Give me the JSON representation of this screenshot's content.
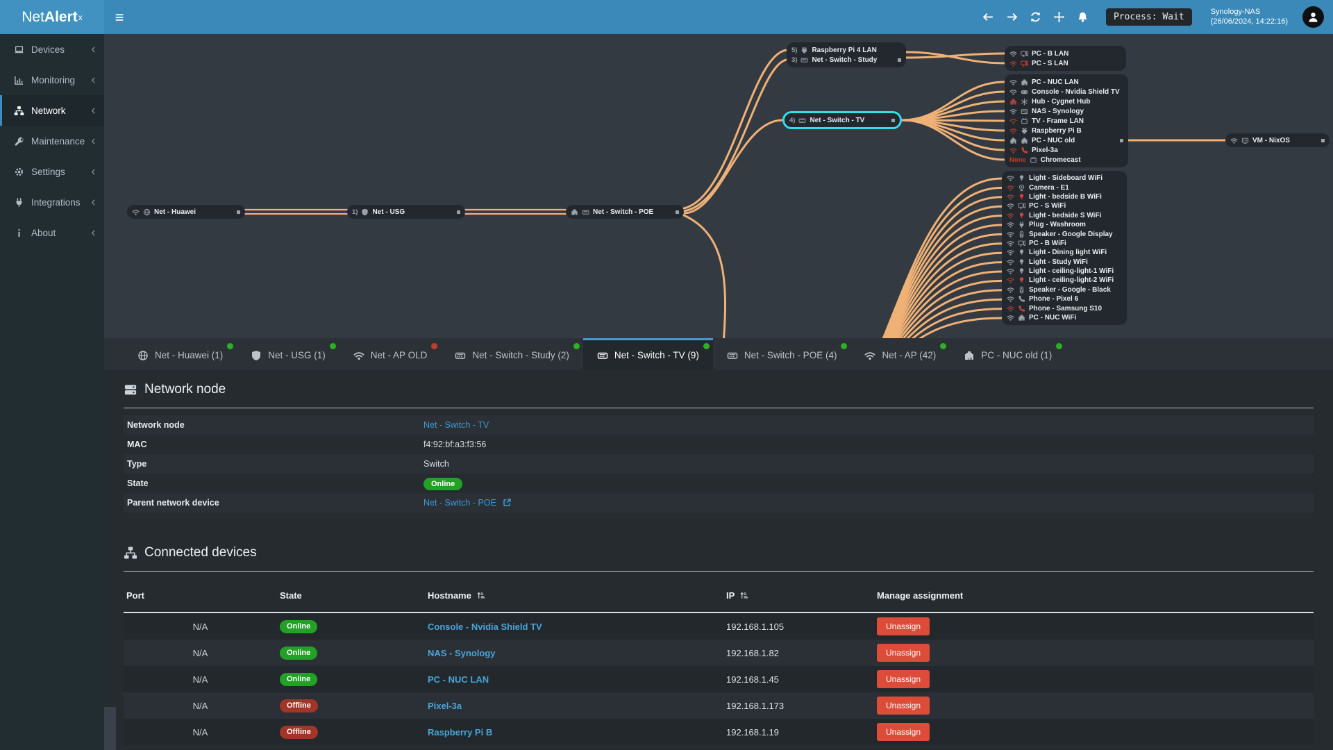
{
  "topbar": {
    "logo_net": "Net",
    "logo_alert": "Alert",
    "logo_sup": "x",
    "process_label": "Process: Wait",
    "host": "Synology-NAS",
    "timestamp": "(26/06/2024, 14:22:16)"
  },
  "sidebar": {
    "items": [
      {
        "icon": "laptop",
        "label": "Devices"
      },
      {
        "icon": "chart",
        "label": "Monitoring"
      },
      {
        "icon": "sitemap",
        "label": "Network",
        "cls": "active"
      },
      {
        "icon": "wrench",
        "label": "Maintenance"
      },
      {
        "icon": "gear",
        "label": "Settings"
      },
      {
        "icon": "plug",
        "label": "Integrations"
      },
      {
        "icon": "info",
        "label": "About"
      }
    ]
  },
  "diagram": {
    "edge_color": "#efb176",
    "selected_ring_color": "#2fdfe9",
    "chain": [
      {
        "conn": "wifi",
        "dev": "globe",
        "label": "Net - Huawei",
        "handle": "on"
      },
      {
        "prefix": "1)",
        "dev": "shield",
        "label": "Net - USG",
        "handle": "on"
      },
      {
        "conn": "ethernet",
        "dev": "switch",
        "label": "Net - Switch - POE",
        "handle": "on"
      }
    ],
    "study_cluster": [
      {
        "prefix": "5)",
        "dev": "raspberry",
        "label": "Raspberry Pi 4 LAN"
      },
      {
        "prefix": "3)",
        "dev": "switch",
        "label": "Net - Switch - Study",
        "handle": "on"
      }
    ],
    "lan_cluster": [
      {
        "conn": "wifi",
        "dev": "desktop",
        "label": "PC - B LAN"
      },
      {
        "conn": "wifi",
        "dev": "desktop",
        "label": "PC - S LAN",
        "status": "offline",
        "devred": "red"
      }
    ],
    "selected": {
      "prefix": "4)",
      "icon": "switch",
      "label": "Net - Switch - TV"
    },
    "tv_cluster": [
      {
        "conn": "wifi",
        "dev": "ethernet",
        "label": "PC - NUC LAN"
      },
      {
        "conn": "wifi",
        "dev": "gamepad",
        "label": "Console - Nvidia Shield TV"
      },
      {
        "conn": "ethernet",
        "dev": "hub",
        "label": "Hub - Cygnet Hub",
        "status": "offline"
      },
      {
        "conn": "wifi",
        "dev": "nas",
        "label": "NAS - Synology"
      },
      {
        "conn": "wifi",
        "dev": "tv",
        "label": "TV - Frame LAN",
        "status": "offline"
      },
      {
        "conn": "wifi",
        "dev": "raspberry",
        "label": "Raspberry Pi B",
        "status": "offline"
      },
      {
        "conn": "ethernet",
        "dev": "ethernet",
        "label": "PC - NUC old",
        "handle": "on"
      },
      {
        "conn": "wifi",
        "dev": "phone",
        "label": "Pixel-3a",
        "status": "offline",
        "devred": "red"
      },
      {
        "prefix": "None",
        "pclass": "red",
        "dev": "tv",
        "label": "Chromecast"
      }
    ],
    "vm": {
      "conn": "wifi",
      "dev": "vm",
      "label": "VM - NixOS",
      "handle": "on"
    },
    "ap_cluster": [
      {
        "conn": "wifi",
        "dev": "bulb",
        "label": "Light - Sideboard WiFi"
      },
      {
        "conn": "wifi",
        "dev": "camera",
        "label": "Camera - E1",
        "status": "offline"
      },
      {
        "conn": "wifi",
        "dev": "bulb",
        "label": "Light - bedside B WiFi",
        "status": "offline",
        "devred": "red"
      },
      {
        "conn": "wifi",
        "dev": "desktop",
        "label": "PC - S WiFi"
      },
      {
        "conn": "wifi",
        "dev": "bulb",
        "label": "Light - bedside S WiFi",
        "status": "offline",
        "devred": "red"
      },
      {
        "conn": "wifi",
        "dev": "plug",
        "label": "Plug - Washroom"
      },
      {
        "conn": "wifi",
        "dev": "speaker",
        "label": "Speaker - Google Display"
      },
      {
        "conn": "wifi",
        "dev": "desktop",
        "label": "PC - B WiFi"
      },
      {
        "conn": "wifi",
        "dev": "bulb",
        "label": "Light - Dining light WiFi"
      },
      {
        "conn": "wifi",
        "dev": "bulb",
        "label": "Light - Study WiFi"
      },
      {
        "conn": "wifi",
        "dev": "bulb",
        "label": "Light - ceiling-light-1 WiFi"
      },
      {
        "conn": "wifi",
        "dev": "bulb",
        "label": "Light - ceiling-light-2 WiFi",
        "status": "offline",
        "devred": "red"
      },
      {
        "conn": "wifi",
        "dev": "speaker",
        "label": "Speaker - Google - Black"
      },
      {
        "conn": "wifi",
        "dev": "phone",
        "label": "Phone - Pixel 6"
      },
      {
        "conn": "wifi",
        "dev": "phone",
        "label": "Phone - Samsung S10",
        "status": "offline",
        "devred": "red"
      },
      {
        "conn": "wifi",
        "dev": "ethernet",
        "label": "PC - NUC WiFi"
      }
    ]
  },
  "tabs": [
    {
      "icon": "globe",
      "label": "Net - Huawei (1)",
      "dot": "green"
    },
    {
      "icon": "shield",
      "label": "Net - USG (1)",
      "dot": "green"
    },
    {
      "icon": "wifi",
      "label": "Net - AP OLD",
      "dot": "red"
    },
    {
      "icon": "switch",
      "label": "Net - Switch - Study (2)",
      "dot": "green"
    },
    {
      "icon": "switch",
      "label": "Net - Switch - TV (9)",
      "dot": "green",
      "cls": "active"
    },
    {
      "icon": "switch",
      "label": "Net - Switch - POE (4)",
      "dot": "green"
    },
    {
      "icon": "wifi",
      "label": "Net - AP (42)",
      "dot": "green"
    },
    {
      "icon": "ethernet",
      "label": "PC - NUC old (1)",
      "dot": "green"
    }
  ],
  "network_node_section": {
    "title": "Network node",
    "rows": [
      {
        "label": "Network node",
        "value": "Net - Switch - TV",
        "type": "link"
      },
      {
        "label": "MAC",
        "value": "f4:92:bf:a3:f3:56"
      },
      {
        "label": "Type",
        "value": "Switch"
      },
      {
        "label": "State",
        "value": "Online",
        "type": "badge"
      },
      {
        "label": "Parent network device",
        "value": "Net - Switch - POE",
        "type": "link",
        "ext": "on"
      }
    ]
  },
  "connected_devices": {
    "title": "Connected devices",
    "headers": {
      "port": "Port",
      "state": "State",
      "hostname": "Hostname",
      "ip": "IP",
      "manage": "Manage assignment"
    },
    "rows": [
      {
        "port": "N/A",
        "state": "Online",
        "state_cls": "online",
        "hostname": "Console - Nvidia Shield TV",
        "ip": "192.168.1.105",
        "action": "Unassign"
      },
      {
        "port": "N/A",
        "state": "Online",
        "state_cls": "online",
        "hostname": "NAS - Synology",
        "ip": "192.168.1.82",
        "action": "Unassign"
      },
      {
        "port": "N/A",
        "state": "Online",
        "state_cls": "online",
        "hostname": "PC - NUC LAN",
        "ip": "192.168.1.45",
        "action": "Unassign"
      },
      {
        "port": "N/A",
        "state": "Offline",
        "state_cls": "offline",
        "hostname": "Pixel-3a",
        "ip": "192.168.1.173",
        "action": "Unassign"
      },
      {
        "port": "N/A",
        "state": "Offline",
        "state_cls": "offline",
        "hostname": "Raspberry Pi B",
        "ip": "192.168.1.19",
        "action": "Unassign"
      }
    ]
  },
  "colors": {
    "topbar": "#3a89b9",
    "sidebar": "#222d32",
    "accent": "#3c8dbc",
    "diagram_bg": "#343a41",
    "node_bg": "#23282e",
    "edge": "#efb176",
    "selected_ring": "#2fdfe9",
    "online": "#23a127",
    "offline_pill": "#a23527",
    "danger": "#dd4b39",
    "link": "#4aa4d9",
    "dot_green": "#2db024",
    "dot_red": "#c23c2b"
  }
}
